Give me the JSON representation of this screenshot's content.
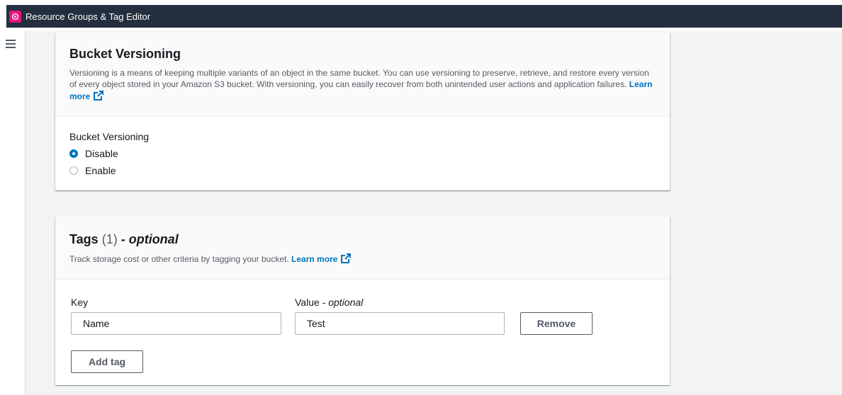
{
  "app": {
    "title": "Resource Groups & Tag Editor"
  },
  "versioning": {
    "title": "Bucket Versioning",
    "description": "Versioning is a means of keeping multiple variants of an object in the same bucket. You can use versioning to preserve, retrieve, and restore every version of every object stored in your Amazon S3 bucket. With versioning, you can easily recover from both unintended user actions and application failures.",
    "learn_more": "Learn more",
    "field_label": "Bucket Versioning",
    "options": [
      {
        "label": "Disable",
        "selected": true
      },
      {
        "label": "Enable",
        "selected": false
      }
    ]
  },
  "tags": {
    "title": "Tags",
    "count": "(1)",
    "optional_prefix": " - ",
    "optional": "optional",
    "description": "Track storage cost or other criteria by tagging your bucket.",
    "learn_more": "Learn more",
    "key_label": "Key",
    "value_label": "Value - ",
    "value_optional": "optional",
    "rows": [
      {
        "key": "Name",
        "value": "Test"
      }
    ],
    "remove_label": "Remove",
    "add_tag_label": "Add tag"
  },
  "colors": {
    "accent": "#0073bb",
    "topbar": "#232f3e",
    "logo": "#e7157b"
  },
  "icons": {
    "menu": "hamburger-icon",
    "external": "external-link-icon",
    "app": "resource-groups-icon"
  }
}
